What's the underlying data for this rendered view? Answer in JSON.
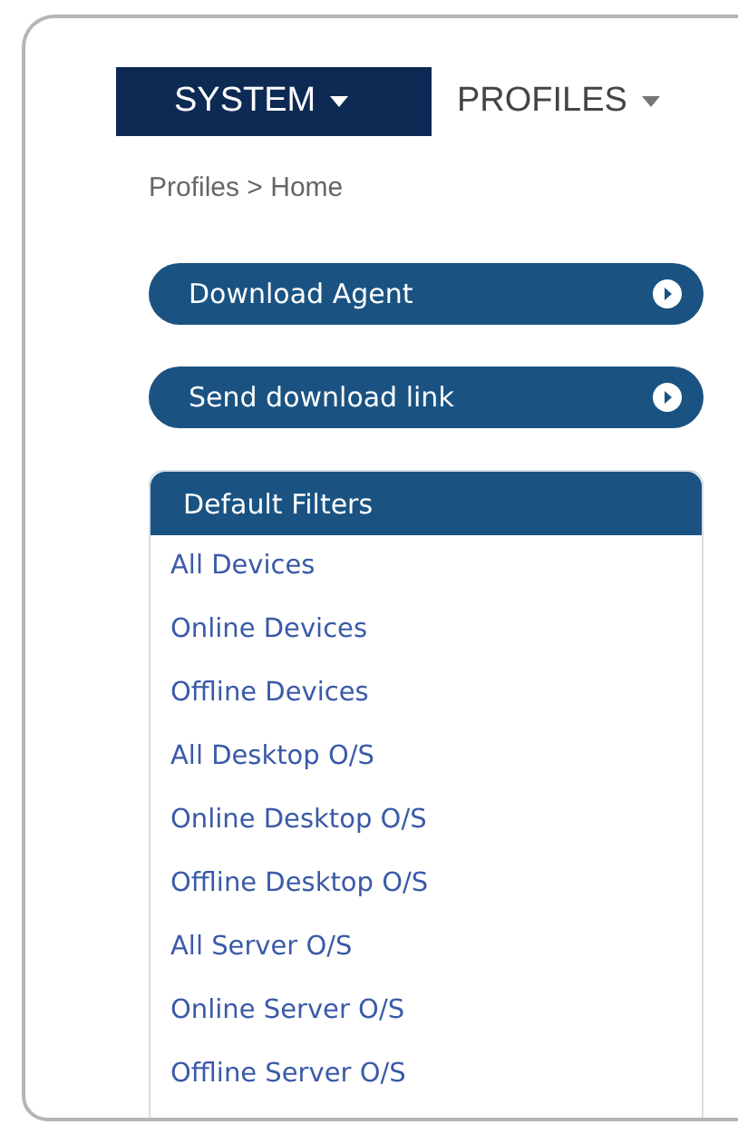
{
  "nav_tabs": [
    {
      "label": "SYSTEM",
      "selected": true
    },
    {
      "label": "PROFILES",
      "selected": false
    }
  ],
  "breadcrumb": "Profiles > Home",
  "action_buttons": [
    "Download Agent",
    "Send download link"
  ],
  "filters": {
    "title": "Default Filters",
    "items": [
      "All Devices",
      "Online Devices",
      "Offline Devices",
      "All Desktop O/S",
      "Online Desktop O/S",
      "Offline Desktop O/S",
      "All Server O/S",
      "Online Server O/S",
      "Offline Server O/S"
    ]
  }
}
